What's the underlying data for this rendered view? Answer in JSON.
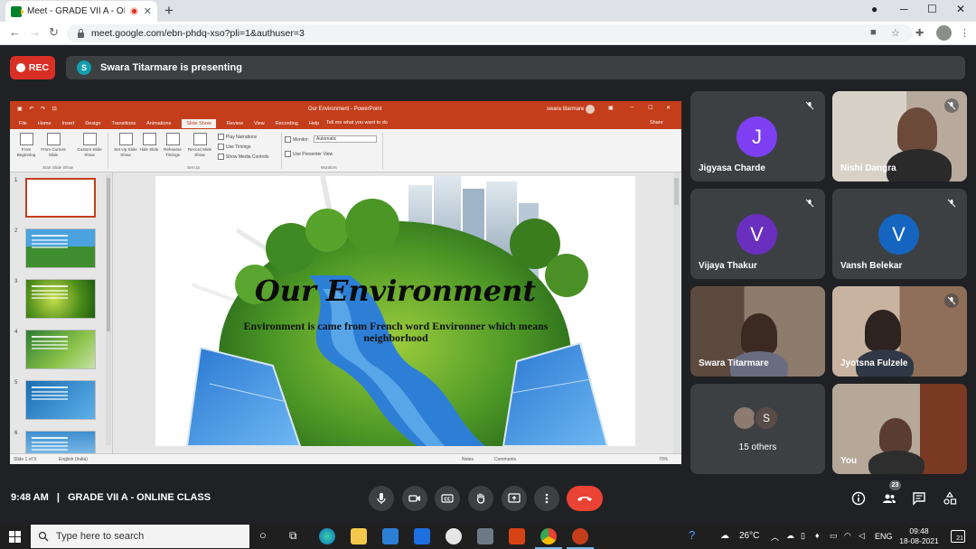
{
  "browser": {
    "tab_title": "Meet - GRADE VII A - ONLIN",
    "tab_close": "✕",
    "new_tab": "+",
    "url": "meet.google.com/ebn-phdq-xso?pli=1&authuser=3",
    "window_controls": [
      "─",
      "☐",
      "✕"
    ]
  },
  "meet": {
    "rec_label": "REC",
    "presenter_initial": "S",
    "presenting_text": "Swara Titarmare is presenting",
    "meeting_time": "9:48 AM",
    "meeting_separator": "|",
    "meeting_name": "GRADE VII A - ONLINE CLASS",
    "people_count": "23",
    "colors": {
      "rec": "#d93025",
      "hangup": "#ea4335",
      "tile": "#3c4043",
      "background": "#202124"
    }
  },
  "powerpoint": {
    "window_title": "Our Environment - PowerPoint",
    "user_name": "swara titarmare",
    "tabs": [
      "File",
      "Home",
      "Insert",
      "Design",
      "Transitions",
      "Animations",
      "Slide Show",
      "Review",
      "View",
      "Recording",
      "Help"
    ],
    "active_tab": "Slide Show",
    "tell_me": "Tell me what you want to do",
    "share_label": "Share",
    "ribbon": {
      "from_beginning": "From Beginning",
      "from_current": "From Current Slide",
      "custom_slide_show": "Custom Slide Show",
      "group_start": "Start Slide Show",
      "set_up_show": "Set Up Slide Show",
      "hide_slide": "Hide Slide",
      "rehearse": "Rehearse Timings",
      "record": "Record Slide Show",
      "play_narrations": "Play Narrations",
      "use_timings": "Use Timings",
      "show_media_controls": "Show Media Controls",
      "group_setup": "Set Up",
      "monitor_label": "Monitor:",
      "monitor_value": "Automatic",
      "use_presenter_view": "Use Presenter View",
      "group_monitors": "Monitors"
    },
    "slide_numbers": [
      "1",
      "2",
      "3",
      "4",
      "5",
      "6"
    ],
    "slide": {
      "title": "Our Environment",
      "subtitle": "Environment is came from French word Environner which means neighborhood"
    },
    "status": {
      "slide_info": "Slide 1 of 9",
      "language": "English (India)",
      "notes": "Notes",
      "comments": "Comments",
      "zoom": "70%"
    }
  },
  "participants": [
    {
      "name": "Jigyasa Charde",
      "initial": "J",
      "avatar_color": "#7e3ff2",
      "muted": true,
      "video": false
    },
    {
      "name": "Nishi Dangra",
      "initial": "",
      "muted": true,
      "video": true
    },
    {
      "name": "Vijaya Thakur",
      "initial": "V",
      "avatar_color": "#6b2fbf",
      "muted": true,
      "video": false
    },
    {
      "name": "Vansh Belekar",
      "initial": "V",
      "avatar_color": "#1565c0",
      "muted": true,
      "video": false
    },
    {
      "name": "Swara Titarmare",
      "initial": "",
      "muted": false,
      "video": true
    },
    {
      "name": "Jyotsna Fulzele",
      "initial": "",
      "muted": true,
      "video": true
    },
    {
      "name": "15 others",
      "initial": "S",
      "video": false
    },
    {
      "name": "You",
      "initial": "",
      "muted": false,
      "video": true
    }
  ],
  "taskbar": {
    "search_placeholder": "Type here to search",
    "temperature": "26°C",
    "language": "ENG",
    "time": "09:48",
    "date": "18-08-2021",
    "notification_count": "21"
  }
}
